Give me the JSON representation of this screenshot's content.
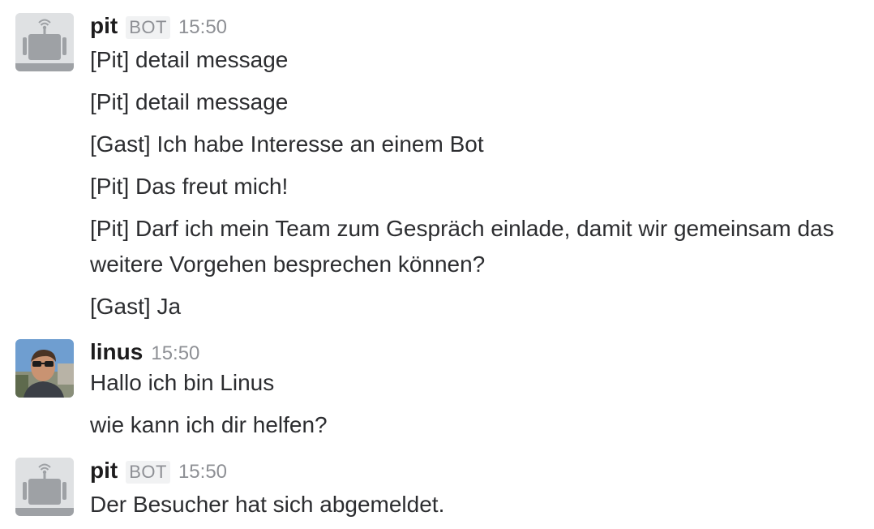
{
  "groups": [
    {
      "user": "pit",
      "badge": "BOT",
      "time": "15:50",
      "avatar_icon": "bot-avatar-icon",
      "messages": [
        "[Pit] detail message",
        "[Pit] detail message",
        "[Gast] Ich habe Interesse an einem Bot",
        "[Pit] Das freut mich!",
        "[Pit] Darf ich mein Team zum Gespräch einlade, damit wir gemeinsam das weitere Vorgehen besprechen können?",
        "[Gast] Ja"
      ]
    },
    {
      "user": "linus",
      "time": "15:50",
      "avatar_icon": "user-photo-avatar",
      "messages": [
        "Hallo ich bin Linus",
        "wie kann ich dir helfen?"
      ]
    },
    {
      "user": "pit",
      "badge": "BOT",
      "time": "15:50",
      "avatar_icon": "bot-avatar-icon",
      "messages": [
        "Der Besucher hat sich abgemeldet."
      ]
    }
  ],
  "colors": {
    "text": "#2c2d30",
    "muted": "#8e9095",
    "badge_bg": "#f1f2f3",
    "bot_avatar_bg": "#dfe1e3",
    "bot_avatar_fg": "#9ea1a5"
  }
}
